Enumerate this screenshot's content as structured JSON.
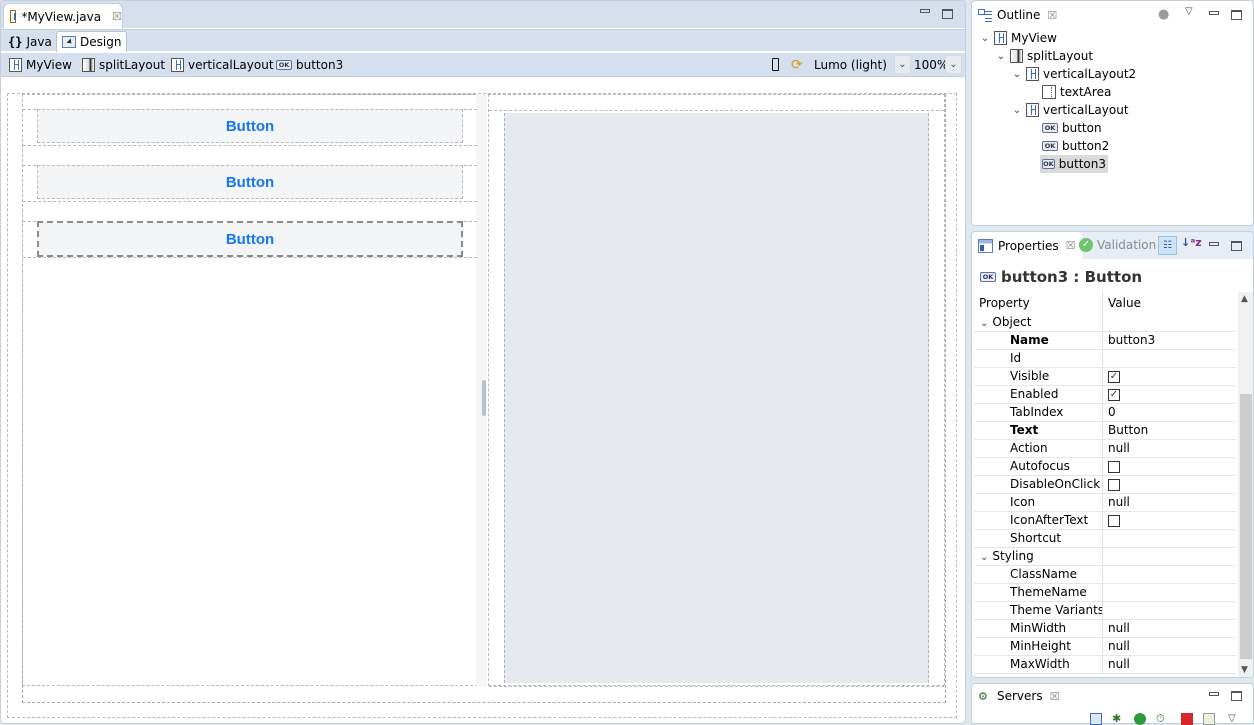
{
  "editor": {
    "tab_title": "*MyView.java",
    "subtabs": [
      {
        "label": "Java",
        "icon": "braces-icon",
        "active": false
      },
      {
        "label": "Design",
        "icon": "design-icon",
        "active": true
      }
    ],
    "breadcrumbs": [
      {
        "label": "MyView",
        "icon": "vertical-layout-icon"
      },
      {
        "label": "splitLayout",
        "icon": "split-layout-icon"
      },
      {
        "label": "verticalLayout",
        "icon": "vertical-layout-icon"
      },
      {
        "label": "button3",
        "icon": "button-icon"
      }
    ],
    "theme": "Lumo (light)",
    "zoom": "100%",
    "canvas": {
      "buttons": [
        {
          "label": "Button",
          "selected": false
        },
        {
          "label": "Button",
          "selected": false
        },
        {
          "label": "Button",
          "selected": true
        }
      ],
      "button_text_color": "#1676f3"
    }
  },
  "outline": {
    "title": "Outline",
    "tree": [
      {
        "label": "MyView",
        "icon": "vertical-layout-icon",
        "expanded": true,
        "level": 0
      },
      {
        "label": "splitLayout",
        "icon": "split-layout-icon",
        "expanded": true,
        "level": 1
      },
      {
        "label": "verticalLayout2",
        "icon": "vertical-layout-icon",
        "expanded": true,
        "level": 2
      },
      {
        "label": "textArea",
        "icon": "text-area-icon",
        "level": 3
      },
      {
        "label": "verticalLayout",
        "icon": "vertical-layout-icon",
        "expanded": true,
        "level": 2
      },
      {
        "label": "button",
        "icon": "button-icon",
        "level": 3
      },
      {
        "label": "button2",
        "icon": "button-icon",
        "level": 3
      },
      {
        "label": "button3",
        "icon": "button-icon",
        "level": 3,
        "selected": true
      }
    ]
  },
  "properties": {
    "tab_title": "Properties",
    "validation_tab": "Validation",
    "selected_title": "button3 : Button",
    "columns": [
      "Property",
      "Value"
    ],
    "rows": [
      {
        "type": "category",
        "name": "Object"
      },
      {
        "name": "Name",
        "value": "button3",
        "bold": true
      },
      {
        "name": "Id",
        "value": ""
      },
      {
        "name": "Visible",
        "checkbox": true,
        "checked": true
      },
      {
        "name": "Enabled",
        "checkbox": true,
        "checked": true
      },
      {
        "name": "TabIndex",
        "value": "0"
      },
      {
        "name": "Text",
        "value": "Button",
        "bold": true
      },
      {
        "name": "Action",
        "value": "null"
      },
      {
        "name": "Autofocus",
        "checkbox": true,
        "checked": false
      },
      {
        "name": "DisableOnClick",
        "checkbox": true,
        "checked": false
      },
      {
        "name": "Icon",
        "value": "null"
      },
      {
        "name": "IconAfterText",
        "checkbox": true,
        "checked": false
      },
      {
        "name": "Shortcut",
        "value": ""
      },
      {
        "type": "category",
        "name": "Styling"
      },
      {
        "name": "ClassName",
        "value": ""
      },
      {
        "name": "ThemeName",
        "value": ""
      },
      {
        "name": "Theme Variants",
        "value": ""
      },
      {
        "name": "MinWidth",
        "value": "null"
      },
      {
        "name": "MinHeight",
        "value": "null"
      },
      {
        "name": "MaxWidth",
        "value": "null"
      }
    ]
  },
  "servers": {
    "title": "Servers",
    "toolbar": [
      "collapse-icon",
      "debug-icon",
      "start-icon",
      "profile-icon",
      "stop-icon",
      "publish-icon",
      "view-menu-icon"
    ]
  },
  "glyphs": {
    "close": "☒",
    "chevron_down": "⌄",
    "check": "✓",
    "ok": "OK",
    "braces": "{}"
  }
}
